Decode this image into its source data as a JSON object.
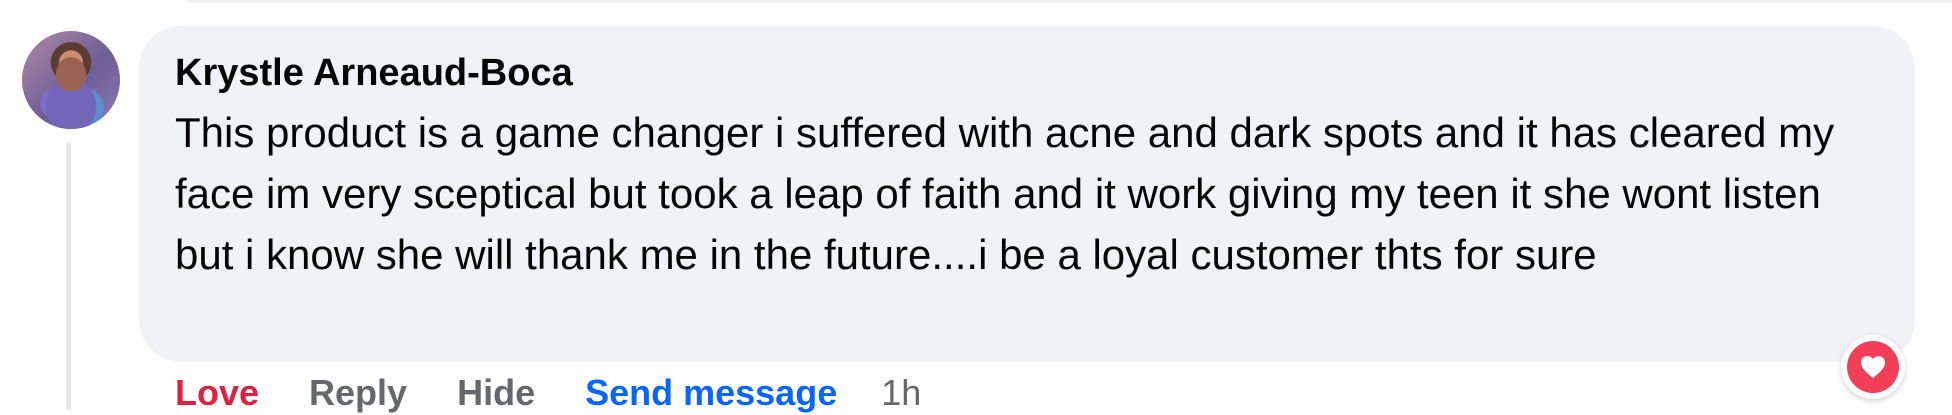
{
  "comment": {
    "author": "Krystle Arneaud-Boca",
    "text": "This product is a game changer i suffered with acne and dark spots and it has cleared my face im very sceptical but took a leap of faith and it work giving my teen it she wont listen but i know she will thank me in the future....i be a loyal customer thts for sure",
    "reaction_icon": "heart-icon"
  },
  "actions": {
    "love": "Love",
    "reply": "Reply",
    "hide": "Hide",
    "send_message": "Send message",
    "timestamp": "1h"
  },
  "colors": {
    "bubble_background": "#f0f2f5",
    "love_red": "#e41e3f",
    "muted_gray": "#65676b",
    "link_blue": "#0866ff",
    "reaction_red": "#f33e58"
  }
}
